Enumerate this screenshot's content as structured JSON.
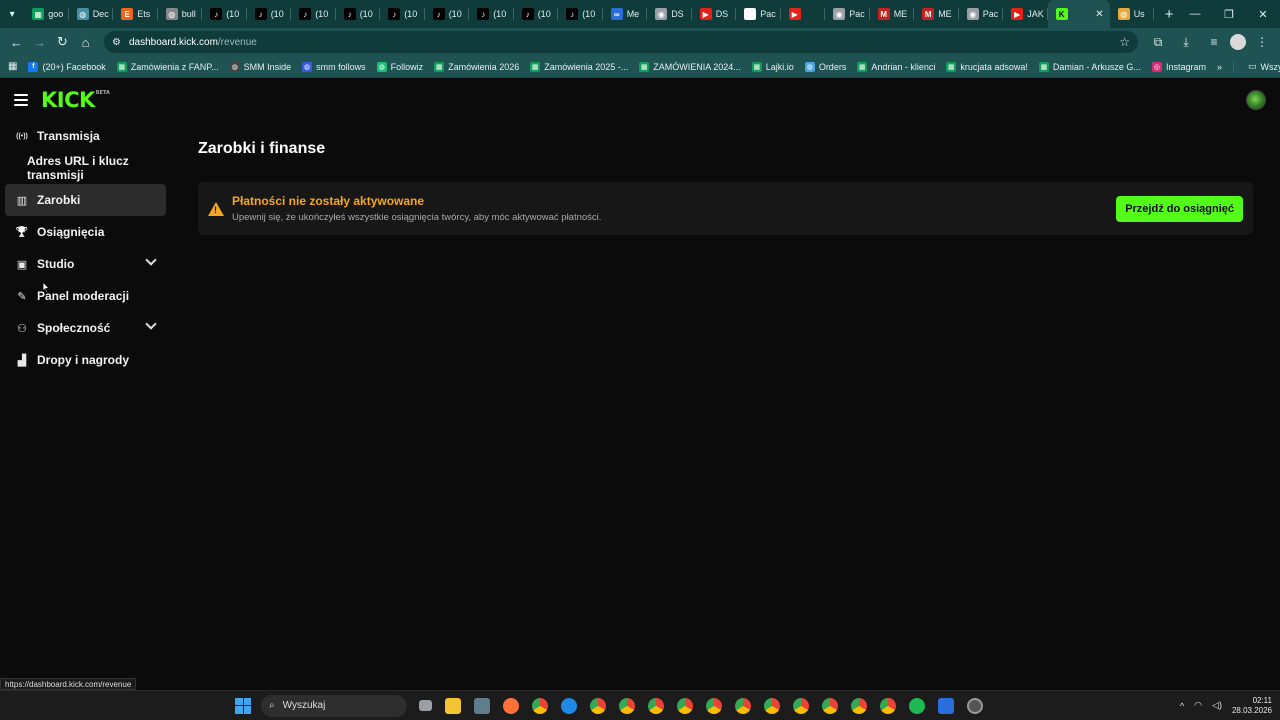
{
  "browser": {
    "tabs": [
      {
        "label": "goo",
        "icon": "sheets-icon",
        "color": "#0f9d58"
      },
      {
        "label": "Dec",
        "icon": "globe-icon",
        "color": "#4a90a4"
      },
      {
        "label": "Ets",
        "icon": "etsy-icon",
        "color": "#f1641e"
      },
      {
        "label": "bull",
        "icon": "globe-icon",
        "color": "#888888"
      },
      {
        "label": "(10",
        "icon": "tiktok-icon",
        "color": "#000000"
      },
      {
        "label": "(10",
        "icon": "tiktok-icon",
        "color": "#000000"
      },
      {
        "label": "(10",
        "icon": "tiktok-icon",
        "color": "#000000"
      },
      {
        "label": "(10",
        "icon": "tiktok-icon",
        "color": "#000000"
      },
      {
        "label": "(10",
        "icon": "tiktok-icon",
        "color": "#000000"
      },
      {
        "label": "(10",
        "icon": "tiktok-icon",
        "color": "#000000"
      },
      {
        "label": "(10",
        "icon": "tiktok-icon",
        "color": "#000000"
      },
      {
        "label": "(10",
        "icon": "tiktok-icon",
        "color": "#000000"
      },
      {
        "label": "(10",
        "icon": "tiktok-icon",
        "color": "#000000"
      },
      {
        "label": "Me",
        "icon": "meta-icon",
        "color": "#2a6edb"
      },
      {
        "label": "DS",
        "icon": "chrome-icon",
        "color": "#9aa0a6"
      },
      {
        "label": "DS",
        "icon": "youtube-icon",
        "color": "#e62117"
      },
      {
        "label": "Pac",
        "icon": "chrome-icon",
        "color": "#ffffff"
      },
      {
        "label": "",
        "icon": "youtube-icon",
        "color": "#e62117"
      },
      {
        "label": "Pac",
        "icon": "chrome-icon",
        "color": "#9aa0a6"
      },
      {
        "label": "ME",
        "icon": "gmail-icon",
        "color": "#c5221f"
      },
      {
        "label": "ME",
        "icon": "gmail-icon",
        "color": "#c5221f"
      },
      {
        "label": "Pac",
        "icon": "chrome-icon",
        "color": "#9aa0a6"
      },
      {
        "label": "JAK",
        "icon": "youtube-icon",
        "color": "#e62117"
      },
      {
        "label": "",
        "icon": "kick-icon",
        "color": "#53fc18",
        "active": true
      },
      {
        "label": "Us",
        "icon": "globe-icon",
        "color": "#e8a93b"
      }
    ],
    "url_host": "dashboard.kick.com",
    "url_path": "/revenue",
    "bookmarks": [
      {
        "label": "(20+) Facebook",
        "icon": "facebook-icon",
        "color": "#1877f2"
      },
      {
        "label": "Zamówienia z FANP...",
        "icon": "sheets-icon",
        "color": "#0f9d58"
      },
      {
        "label": "SMM Inside",
        "icon": "globe-icon",
        "color": "#444444"
      },
      {
        "label": "smm follows",
        "icon": "globe-icon",
        "color": "#3b5bdb"
      },
      {
        "label": "Followiz",
        "icon": "globe-icon",
        "color": "#1fbf73"
      },
      {
        "label": "Zamówienia 2026",
        "icon": "sheets-icon",
        "color": "#0f9d58"
      },
      {
        "label": "Zamówienia 2025 -...",
        "icon": "sheets-icon",
        "color": "#0f9d58"
      },
      {
        "label": "ZAMÓWIENIA 2024...",
        "icon": "sheets-icon",
        "color": "#0f9d58"
      },
      {
        "label": "Lajki.io",
        "icon": "sheets-icon",
        "color": "#0f9d58"
      },
      {
        "label": "Orders",
        "icon": "globe-icon",
        "color": "#4aa3df"
      },
      {
        "label": "Andrian - klienci",
        "icon": "sheets-icon",
        "color": "#0f9d58"
      },
      {
        "label": "krucjata adsowa!",
        "icon": "sheets-icon",
        "color": "#0f9d58"
      },
      {
        "label": "Damian - Arkusze G...",
        "icon": "sheets-icon",
        "color": "#0f9d58"
      },
      {
        "label": "Instagram",
        "icon": "instagram-icon",
        "color": "#d62976"
      }
    ],
    "bookmarks_more": "»",
    "all_bookmarks": "Wszystkie zakładki",
    "status_url": "https://dashboard.kick.com/revenue"
  },
  "app": {
    "logo": "KICK",
    "logo_badge": "BETA",
    "sidebar": [
      {
        "label": "Transmisja",
        "icon": "broadcast-icon",
        "name": "sidebar-item-transmisja"
      },
      {
        "label": "Adres URL i klucz transmisji",
        "sub": true,
        "name": "sidebar-item-stream-key"
      },
      {
        "label": "Zarobki",
        "icon": "chart-icon",
        "active": true,
        "name": "sidebar-item-zarobki"
      },
      {
        "label": "Osiągnięcia",
        "icon": "trophy-icon",
        "name": "sidebar-item-osiagniecia"
      },
      {
        "label": "Studio",
        "icon": "studio-icon",
        "expandable": true,
        "name": "sidebar-item-studio"
      },
      {
        "label": "Panel moderacji",
        "icon": "wrench-icon",
        "name": "sidebar-item-panel-moderacji"
      },
      {
        "label": "Społeczność",
        "icon": "community-icon",
        "expandable": true,
        "name": "sidebar-item-spolecznosc"
      },
      {
        "label": "Dropy i nagrody",
        "icon": "gift-icon",
        "name": "sidebar-item-dropy"
      }
    ],
    "page_title": "Zarobki i finanse",
    "alert": {
      "title": "Płatności nie zostały aktywowane",
      "description": "Upewnij się, że ukończyłeś wszystkie osiągnięcia twórcy, aby móc aktywować płatności.",
      "button": "Przejdź do osiągnięć"
    }
  },
  "taskbar": {
    "search_placeholder": "Wyszukaj",
    "time": "02:11",
    "date": "28.03.2026"
  },
  "colors": {
    "kick_green": "#53fc18",
    "warning": "#f5a623",
    "browser_frame": "#1f5252"
  }
}
